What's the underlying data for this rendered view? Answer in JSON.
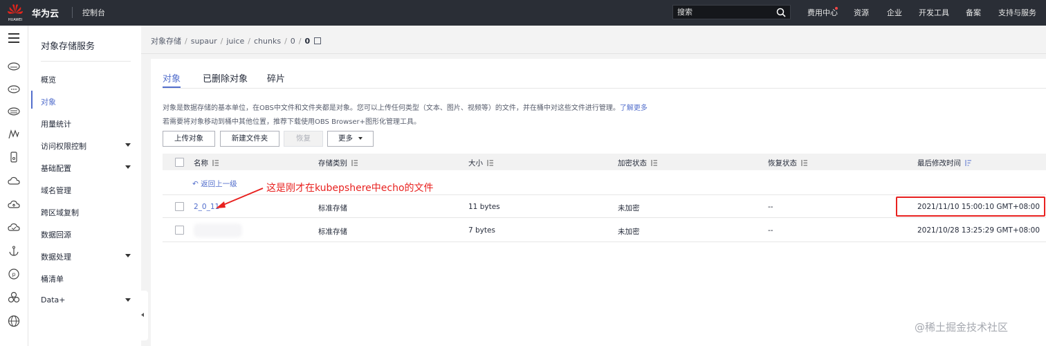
{
  "topbar": {
    "brand": "华为云",
    "logo_text": "HUAWEI",
    "console": "控制台",
    "search_placeholder": "搜索",
    "nav": [
      "费用中心",
      "资源",
      "企业",
      "开发工具",
      "备案",
      "支持与服务"
    ]
  },
  "rail": {
    "icons": [
      "menu-icon",
      "cloud-server-icon",
      "cloud-icon",
      "database-icon",
      "chart-icon",
      "phone-icon",
      "cloud-outline-icon",
      "cloud-upload-icon",
      "cloud-check-icon",
      "anchor-icon",
      "coin-icon",
      "cluster-icon",
      "globe-icon"
    ]
  },
  "sidemenu": {
    "title": "对象存储服务",
    "items": [
      {
        "label": "概览"
      },
      {
        "label": "对象"
      },
      {
        "label": "用量统计"
      },
      {
        "label": "访问权限控制"
      },
      {
        "label": "基础配置"
      },
      {
        "label": "域名管理"
      },
      {
        "label": "跨区域复制"
      },
      {
        "label": "数据回源"
      },
      {
        "label": "数据处理"
      },
      {
        "label": "桶清单"
      },
      {
        "label": "Data+"
      }
    ]
  },
  "breadcrumb": [
    "对象存储",
    "supaur",
    "juice",
    "chunks",
    "0",
    "0"
  ],
  "tabs": [
    "对象",
    "已删除对象",
    "碎片"
  ],
  "description": {
    "line1": "对象是数据存储的基本单位，在OBS中文件和文件夹都是对象。您可以上传任何类型（文本、图片、视频等）的文件，并在桶中对这些文件进行管理。",
    "learn_more": "了解更多",
    "line2": "若需要将对象移动到桶中其他位置，推荐下载使用OBS Browser+图形化管理工具。"
  },
  "toolbar": {
    "upload": "上传对象",
    "new_folder": "新建文件夹",
    "restore": "恢复",
    "more": "更多"
  },
  "table": {
    "columns": [
      "名称",
      "存储类别",
      "大小",
      "加密状态",
      "恢复状态",
      "最后修改时间"
    ],
    "back": "返回上一级",
    "rows": [
      {
        "name": "2_0_11",
        "storage": "标准存储",
        "size": "11 bytes",
        "encryption": "未加密",
        "restore": "--",
        "modified": "2021/11/10 15:00:10 GMT+08:00"
      },
      {
        "name": "",
        "storage": "标准存储",
        "size": "7 bytes",
        "encryption": "未加密",
        "restore": "--",
        "modified": "2021/10/28 13:25:29 GMT+08:00"
      }
    ]
  },
  "annotation": "这是刚才在kubepshere中echo的文件",
  "watermark": "@稀土掘金技术社区",
  "colors": {
    "accent": "#526ecc",
    "annotation": "#e8211f",
    "topbar": "#2a2e36"
  }
}
